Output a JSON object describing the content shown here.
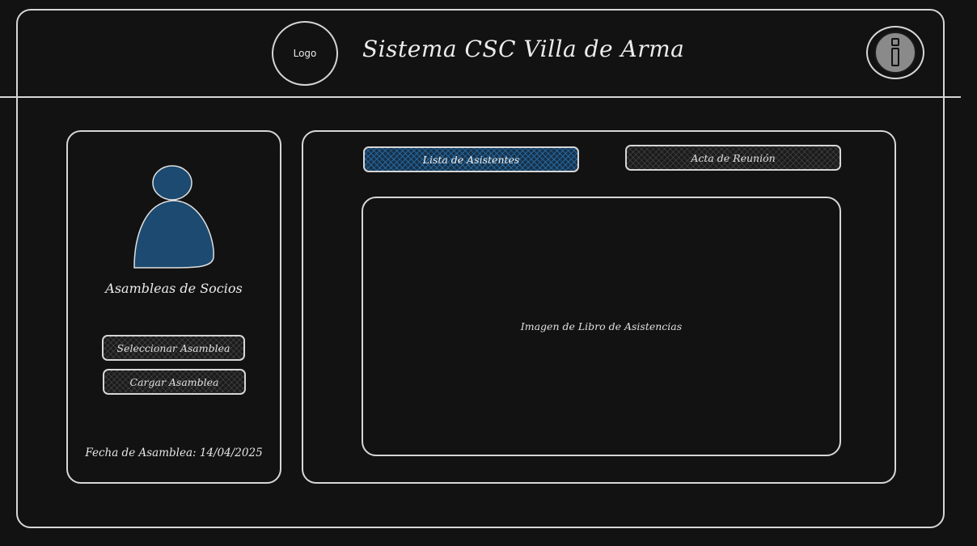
{
  "header": {
    "logo_text": "Logo",
    "title": "Sistema CSC Villa de Arma",
    "info_icon": "info-icon"
  },
  "sidebar": {
    "avatar_icon": "user-avatar-icon",
    "section_title": "Asambleas de Socios",
    "buttons": [
      {
        "label": "Seleccionar Asamblea"
      },
      {
        "label": "Cargar Asamblea"
      }
    ],
    "date_label": "Fecha de Asamblea: 14/04/2025"
  },
  "main": {
    "tabs": [
      {
        "label": "Lista de Asistentes",
        "active": true
      },
      {
        "label": "Acta de Reunión",
        "active": false
      }
    ],
    "image_placeholder": "Imagen de Libro de Asistencias"
  },
  "colors": {
    "background": "#121212",
    "stroke": "#d6d6d6",
    "accent_blue": "#1c4a70",
    "info_fill": "#8a8a8a"
  }
}
